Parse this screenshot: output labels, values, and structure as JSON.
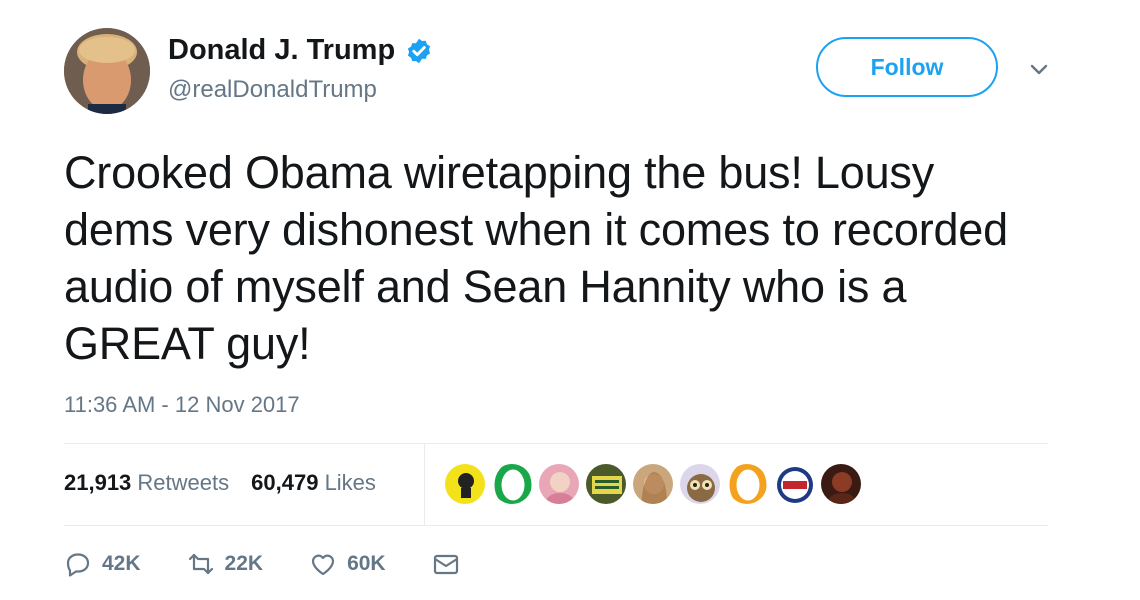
{
  "user": {
    "display_name": "Donald J. Trump",
    "handle": "@realDonaldTrump"
  },
  "header": {
    "follow_label": "Follow"
  },
  "tweet": {
    "text": "Crooked Obama wiretapping the bus! Lousy dems very dishonest when it comes to recorded audio of myself and Sean Hannity who is a GREAT guy!",
    "timestamp": "11:36 AM - 12 Nov 2017"
  },
  "stats": {
    "retweets_count": "21,913",
    "retweets_label": "Retweets",
    "likes_count": "60,479",
    "likes_label": "Likes"
  },
  "likers": [
    {
      "icon": "yellow-circle-avatar"
    },
    {
      "icon": "green-ring-avatar"
    },
    {
      "icon": "pink-avatar"
    },
    {
      "icon": "sign-avatar"
    },
    {
      "icon": "woman-avatar"
    },
    {
      "icon": "owl-avatar"
    },
    {
      "icon": "orange-ring-avatar"
    },
    {
      "icon": "trump-badge-avatar"
    },
    {
      "icon": "dark-avatar"
    }
  ],
  "actions": {
    "reply_count": "42K",
    "retweet_count": "22K",
    "like_count": "60K"
  },
  "colors": {
    "accent": "#1da1f2",
    "muted": "#657786",
    "text": "#14171a"
  }
}
